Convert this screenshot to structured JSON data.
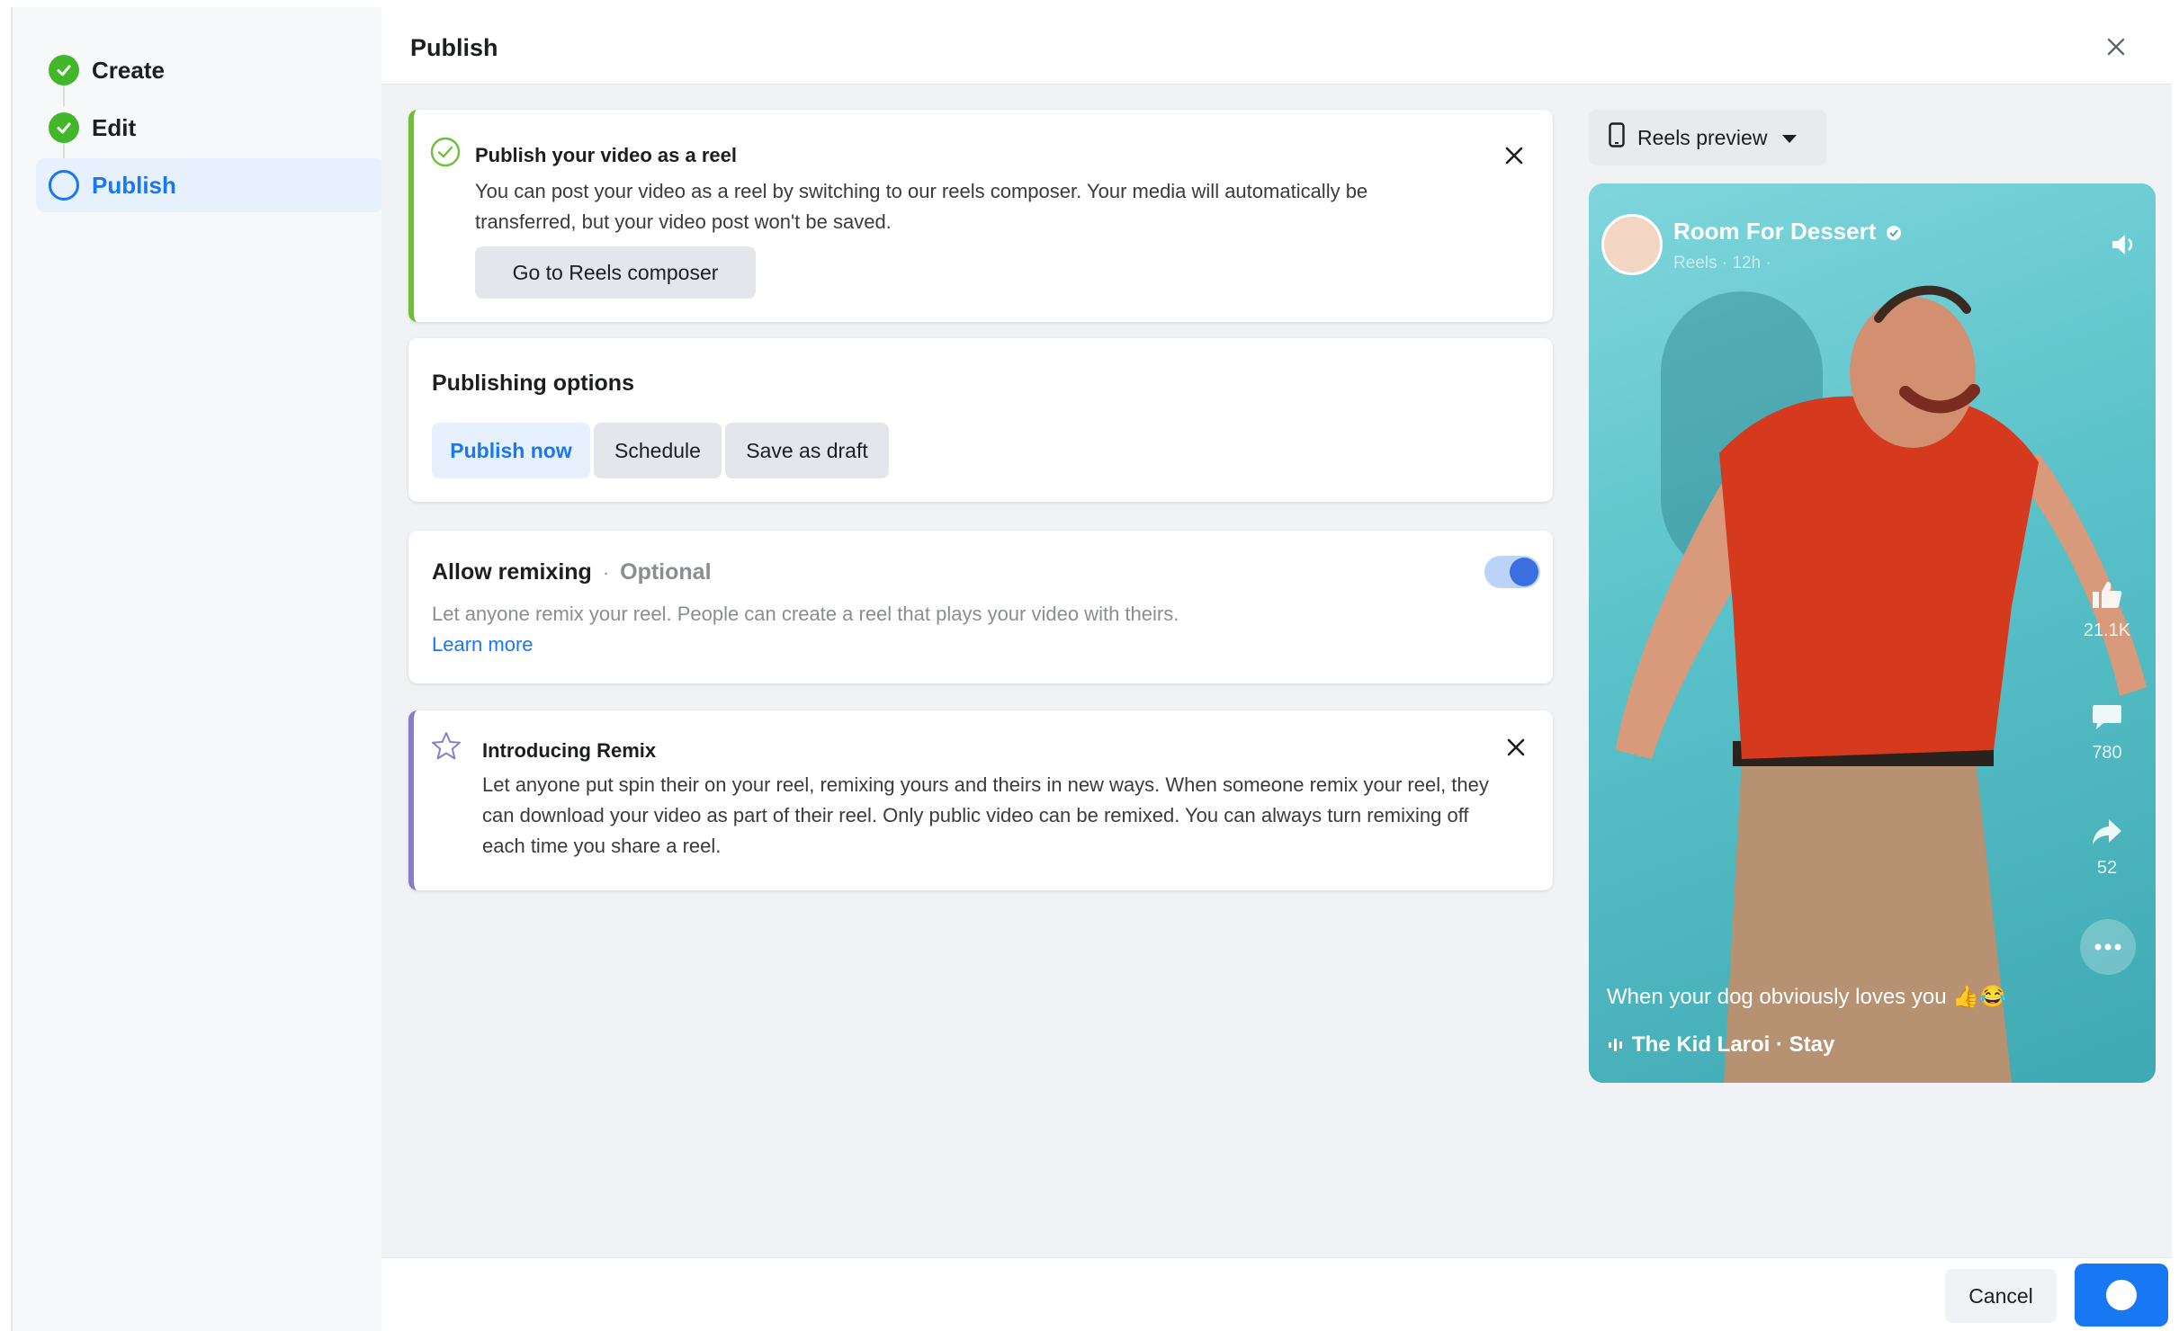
{
  "stepper": {
    "steps": [
      {
        "label": "Create",
        "state": "done"
      },
      {
        "label": "Edit",
        "state": "done"
      },
      {
        "label": "Publish",
        "state": "current"
      }
    ]
  },
  "header": {
    "title": "Publish"
  },
  "reel_notice": {
    "title": "Publish your video as a reel",
    "body": "You can post your video as a reel by switching to our reels composer. Your media will automatically be transferred, but your video post won't be saved.",
    "button": "Go to Reels composer"
  },
  "publishing_options": {
    "title": "Publishing options",
    "options": [
      "Publish now",
      "Schedule",
      "Save as draft"
    ],
    "selected": "Publish now"
  },
  "remixing": {
    "title": "Allow remixing",
    "separator": "·",
    "optional": "Optional",
    "description": "Let anyone remix your reel. People can create a reel that plays your video with theirs.",
    "link": "Learn more",
    "enabled": true
  },
  "remix_intro": {
    "title": "Introducing Remix",
    "body": "Let anyone put spin their on your reel, remixing yours and theirs in new ways. When someone remix your reel, they can download your video as part of their reel. Only public video can be remixed. You can always turn remixing off each time you share a reel."
  },
  "preview": {
    "dropdown_label": "Reels preview",
    "page_name": "Room For Dessert",
    "meta": "Reels · 12h · ",
    "likes": "21.1K",
    "comments": "780",
    "shares": "52",
    "caption": "When your dog obviously loves you 👍😂",
    "audio": "The Kid Laroi · Stay"
  },
  "footer": {
    "cancel": "Cancel"
  },
  "colors": {
    "accent": "#1877f2",
    "success": "#42b72a",
    "reel_bg": "#66c9cf"
  }
}
